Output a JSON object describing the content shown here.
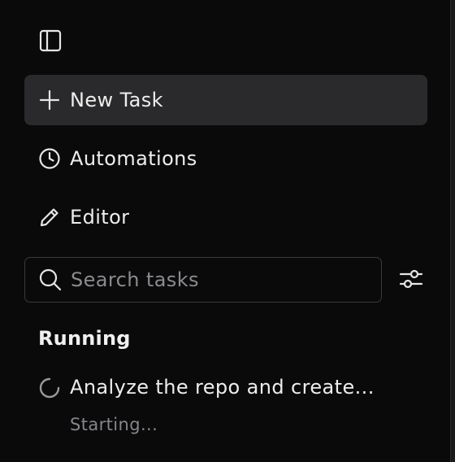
{
  "sidebar": {
    "toggle_icon": "sidebar-panel-icon",
    "nav": [
      {
        "label": "New Task",
        "icon": "plus-icon",
        "active": true
      },
      {
        "label": "Automations",
        "icon": "clock-icon",
        "active": false
      },
      {
        "label": "Editor",
        "icon": "pencil-icon",
        "active": false
      }
    ],
    "search": {
      "placeholder": "Search tasks",
      "value": "",
      "icon": "search-icon"
    },
    "filter_icon": "sliders-icon",
    "sections": [
      {
        "heading": "Running",
        "tasks": [
          {
            "title": "Analyze the repo and create...",
            "status": "Starting...",
            "icon": "spinner-icon"
          }
        ]
      }
    ]
  },
  "colors": {
    "background": "#0a0a0b",
    "active_item": "#2a2a2c",
    "border": "#3a3a3d",
    "text": "#ededed",
    "muted_text": "#85858a"
  }
}
